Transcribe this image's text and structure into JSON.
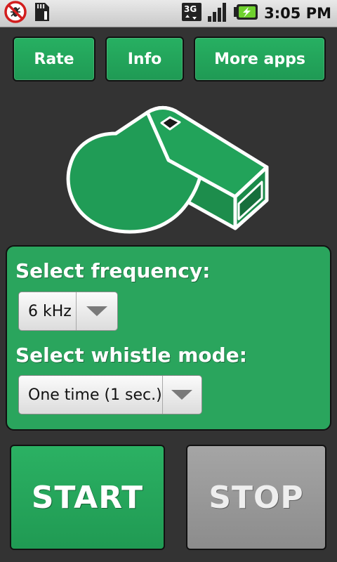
{
  "status_bar": {
    "icons": [
      "no-mosquito-icon",
      "sd-card-icon",
      "3g-icon",
      "signal-icon",
      "battery-charging-icon"
    ],
    "network": "3G",
    "time": "3:05 PM"
  },
  "top_buttons": {
    "rate": "Rate",
    "info": "Info",
    "more_apps": "More apps"
  },
  "settings": {
    "frequency_label": "Select frequency:",
    "frequency_value": "6 kHz",
    "mode_label": "Select whistle mode:",
    "mode_value": "One time (1 sec.)"
  },
  "actions": {
    "start": "START",
    "stop": "STOP"
  },
  "colors": {
    "accent": "#27a85e",
    "background": "#333333",
    "stop_button": "#999999"
  }
}
